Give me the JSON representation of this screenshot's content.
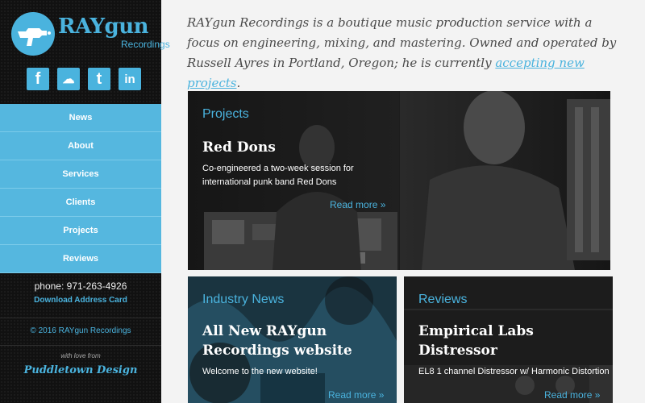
{
  "logo": {
    "title": "RAYgun",
    "subtitle": "Recordings"
  },
  "social": [
    {
      "name": "facebook",
      "glyph": "f"
    },
    {
      "name": "soundcloud",
      "glyph": "☁"
    },
    {
      "name": "twitter",
      "glyph": "t"
    },
    {
      "name": "linkedin",
      "glyph": "in"
    }
  ],
  "nav": [
    "News",
    "About",
    "Services",
    "Clients",
    "Projects",
    "Reviews"
  ],
  "contact": {
    "phone": "phone: 971-263-4926",
    "download": "Download Address Card"
  },
  "copyright": "© 2016 RAYgun Recordings",
  "credit": {
    "love": "with love from",
    "designer": "Puddletown Design"
  },
  "intro": {
    "text": "RAYgun Recordings is a boutique music production service with a focus on engineering, mixing, and mastering. Owned and operated by Russell Ayres in Portland, Oregon; he is currently ",
    "link": "accepting new projects",
    "end": "."
  },
  "cards": [
    {
      "category": "Projects",
      "title": "Red Dons",
      "desc": "Co-engineered a two-week session for international punk band Red Dons",
      "more": "Read more »"
    },
    {
      "category": "Industry News",
      "title": "All New RAYgun Recordings website",
      "desc": "Welcome to the new website!",
      "more": "Read more »"
    },
    {
      "category": "Reviews",
      "title": "Empirical Labs Distressor",
      "desc": "EL8 1 channel Distressor w/ Harmonic Distortion",
      "more": "Read more »"
    }
  ],
  "colors": {
    "accent": "#4ab3de",
    "nav_bg": "#55b7df",
    "sidebar_bg": "#111111"
  }
}
